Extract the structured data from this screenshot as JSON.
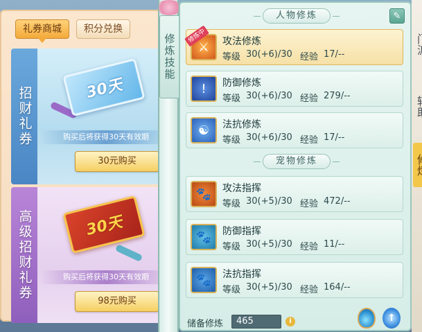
{
  "shop": {
    "tabs": [
      {
        "label": "礼券商城",
        "active": true
      },
      {
        "label": "积分兑换",
        "active": false
      }
    ],
    "cards": [
      {
        "title": "招财礼券",
        "ticket_text": "30天",
        "note": "购买后将获得30天有效期",
        "buy_label": "30元购买"
      },
      {
        "title": "高级招财礼券",
        "ticket_text": "30天",
        "note": "购买后将获得30天有效期",
        "buy_label": "98元购买"
      }
    ]
  },
  "spine_tab": {
    "label": "修炼技能"
  },
  "cultivation": {
    "character_section": "人物修炼",
    "pet_section": "宠物修炼",
    "level_label": "等级",
    "exp_label": "经验",
    "training_badge": "修炼中",
    "character_skills": [
      {
        "name": "攻法修炼",
        "icon": "attack-magic-icon",
        "level": "30(+6)/30",
        "exp": "17/--",
        "selected": true
      },
      {
        "name": "防御修炼",
        "icon": "defense-icon",
        "level": "30(+6)/30",
        "exp": "279/--",
        "selected": false
      },
      {
        "name": "法抗修炼",
        "icon": "magic-resist-icon",
        "level": "30(+6)/30",
        "exp": "17/--",
        "selected": false
      }
    ],
    "pet_skills": [
      {
        "name": "攻法指挥",
        "icon": "pet-attack-icon",
        "level": "30(+5)/30",
        "exp": "472/--"
      },
      {
        "name": "防御指挥",
        "icon": "pet-defense-icon",
        "level": "30(+5)/30",
        "exp": "11/--"
      },
      {
        "name": "法抗指挥",
        "icon": "pet-resist-icon",
        "level": "30(+5)/30",
        "exp": "164/--"
      }
    ],
    "reserve_label": "储备修炼",
    "reserve_value": "465"
  },
  "background": {
    "chars_top": "门派",
    "chars_mid": "辅助",
    "chars_tab": "修炼"
  },
  "colors": {
    "accent_gold": "#f5cf62",
    "panel_teal": "#d6ede7",
    "selected_row": "#f6e0a6"
  }
}
